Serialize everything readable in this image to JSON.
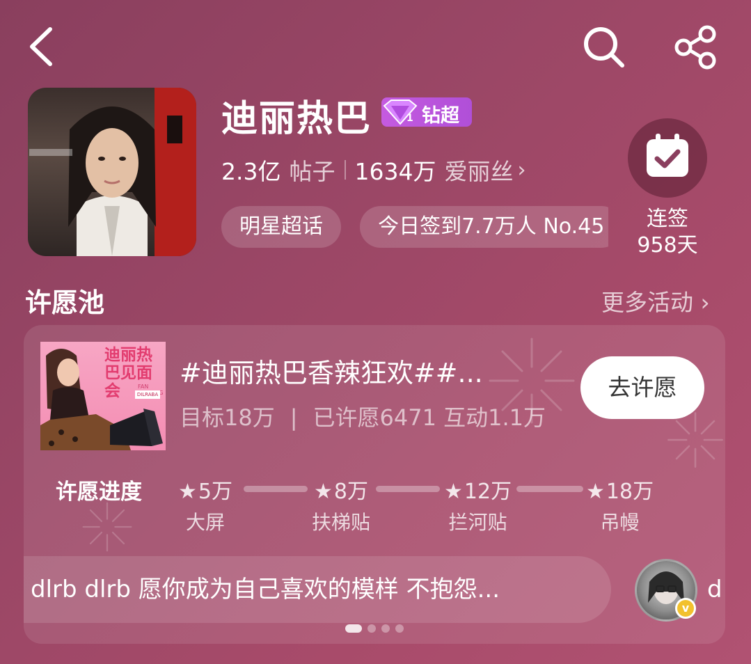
{
  "header": {
    "back_icon": "back-arrow-icon",
    "search_icon": "search-icon",
    "share_icon": "share-icon"
  },
  "profile": {
    "name": "迪丽热巴",
    "badge_label": "钻超",
    "posts_count": "2.3亿",
    "posts_label": "帖子",
    "fans_count": "1634万",
    "fans_label": "爱丽丝",
    "tags": [
      "明星超话",
      "今日签到7.7万人 No.45"
    ],
    "checkin_label": "连签",
    "checkin_days": "958天"
  },
  "wish_section": {
    "title": "许愿池",
    "more_label": "更多活动",
    "card": {
      "poster_title": "迪丽热巴见面会",
      "poster_sub": "FAN MEETING",
      "poster_logo": "DILRABA",
      "title": "#迪丽热巴香辣狂欢##...",
      "goal": "目标18万",
      "separator": "|",
      "wished": "已许愿6471",
      "interactions": "互动1.1万",
      "button_label": "去许愿",
      "progress_label": "许愿进度",
      "milestones": [
        {
          "value": "5万",
          "name": "大屏"
        },
        {
          "value": "8万",
          "name": "扶梯贴"
        },
        {
          "value": "12万",
          "name": "拦河贴"
        },
        {
          "value": "18万",
          "name": "吊幔"
        }
      ],
      "comment_text": "dlrb dlrb 愿你成为自己喜欢的模样 不抱怨...",
      "comment_next_text": "d",
      "pagination": {
        "pages": 4,
        "active_index": 0
      }
    }
  },
  "colors": {
    "background": "#9b4766",
    "badge": "#c55be0",
    "wish_button": "#ffffff",
    "verified_badge": "#f2c12e"
  }
}
